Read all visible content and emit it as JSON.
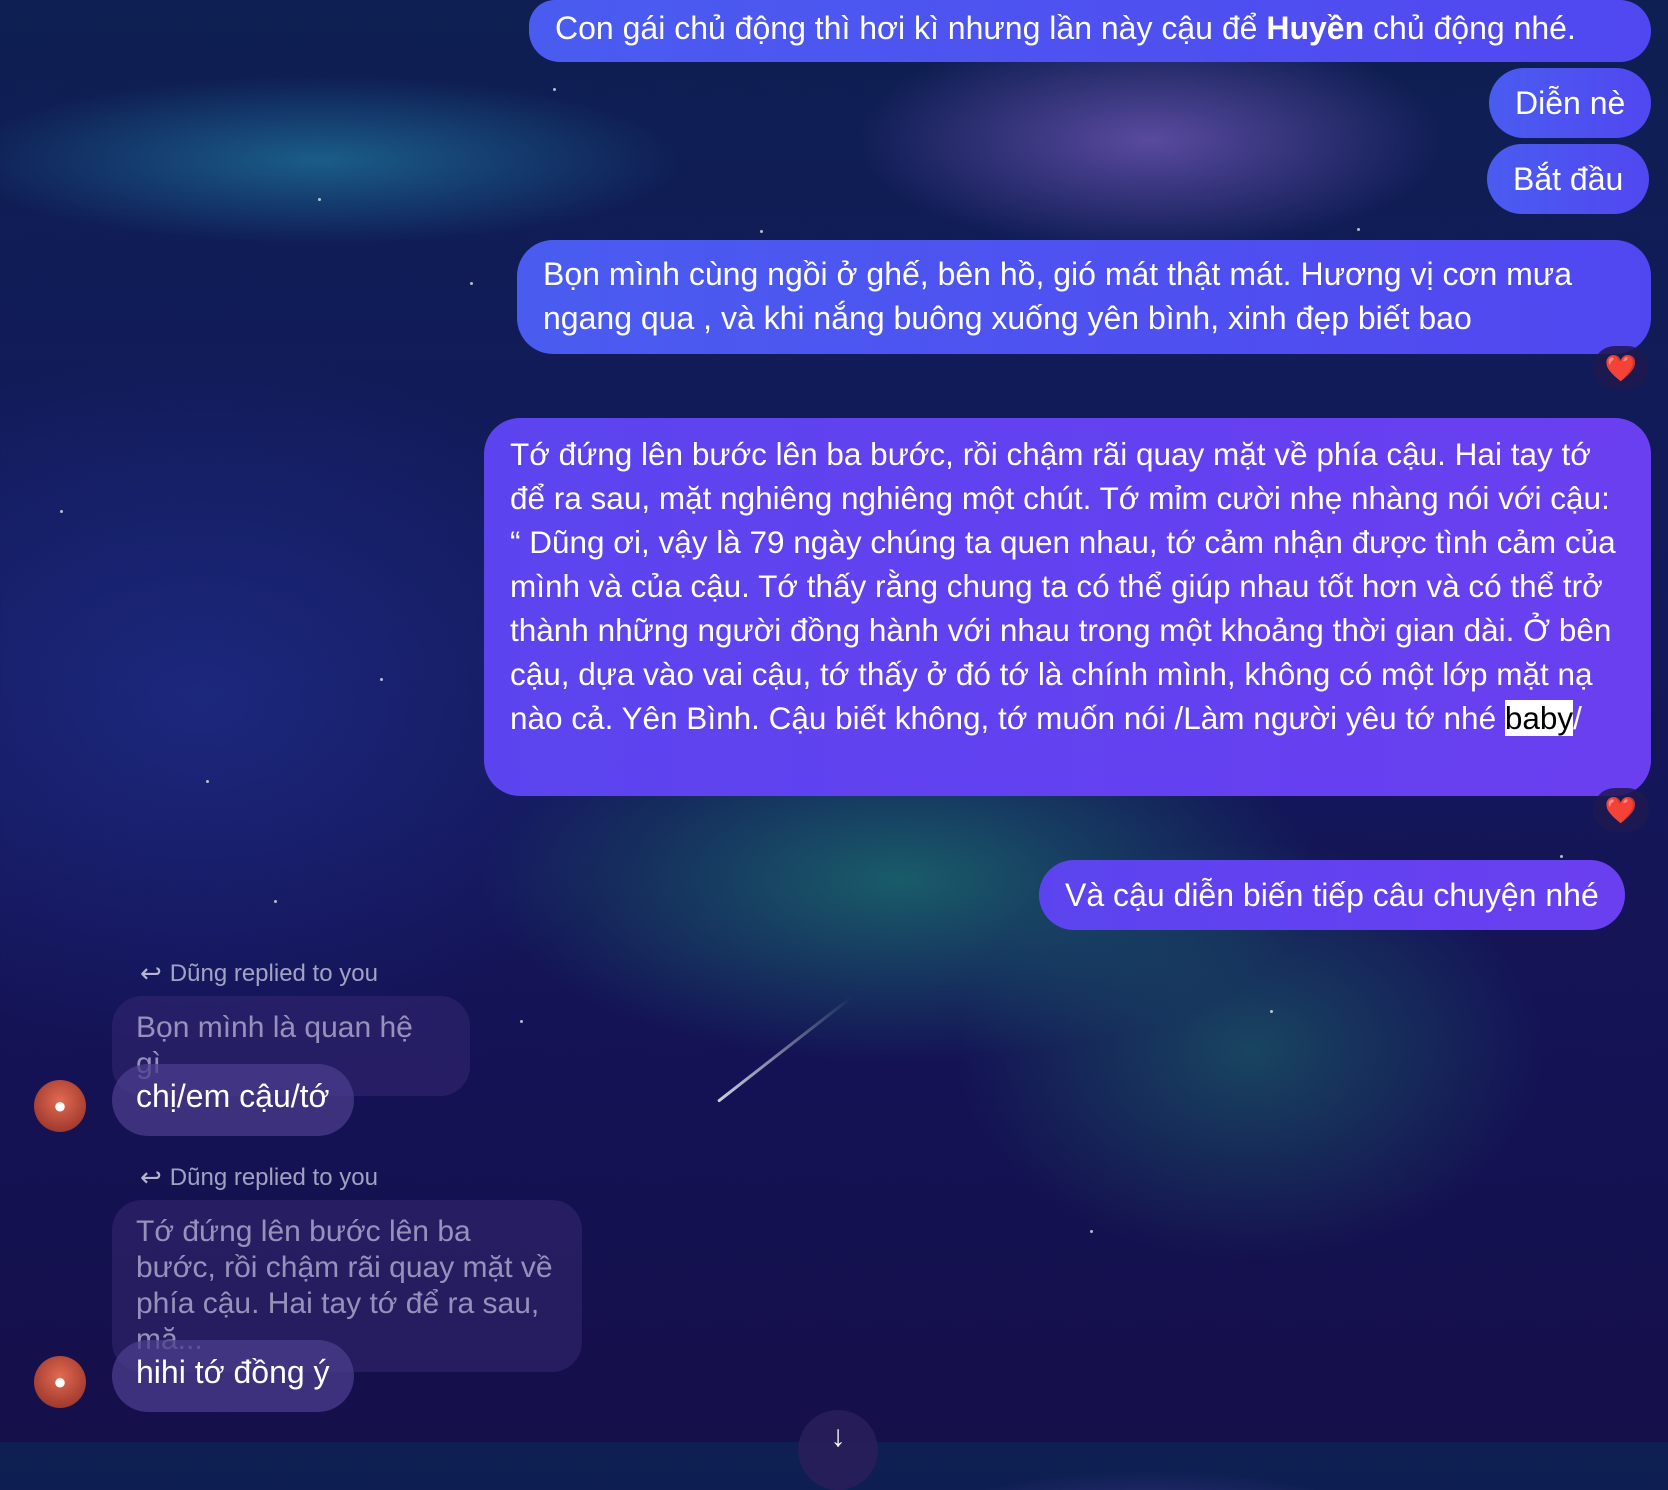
{
  "messages_out": [
    {
      "id": "m1",
      "text_before": "Con gái chủ động thì hơi kì nhưng lần này cậu để ",
      "bold": "Huyền",
      "text_after": " chủ động nhé."
    },
    {
      "id": "m2",
      "text": "Diễn nè"
    },
    {
      "id": "m3",
      "text": "Bắt đầu"
    },
    {
      "id": "m4",
      "text": "Bọn mình cùng ngồi ở ghế, bên hồ, gió mát thật mát. Hương vị cơn mưa ngang qua , và khi nắng buông xuống yên bình, xinh đẹp biết bao",
      "reaction": "❤️"
    },
    {
      "id": "m5",
      "text_main": "Tớ đứng lên bước lên ba bước, rồi chậm rãi quay mặt về phía cậu. Hai tay tớ để ra sau, mặt nghiêng nghiêng một chút. Tớ mỉm cười nhẹ nhàng nói với cậu: “ Dũng ơi, vậy là 79 ngày chúng ta quen nhau, tớ cảm nhận được tình cảm của mình và của cậu. Tớ thấy rằng chung ta có thể giúp nhau tốt hơn và có thể trở thành những người đồng hành với nhau trong một khoảng thời gian dài. Ở bên cậu, dựa vào vai cậu, tớ thấy ở đó tớ là chính mình, không có một lớp mặt nạ nào cả. Yên Bình. Cậu biết không, tớ muốn nói /Làm người yêu tớ nhé ",
      "text_highlight": "baby",
      "text_end": "/",
      "reaction": "❤️"
    },
    {
      "id": "m6",
      "text": "Và cậu diễn biến tiếp câu chuyện nhé"
    }
  ],
  "replies": [
    {
      "label": "Dũng replied to you",
      "quoted": "Bọn mình là quan hệ gì",
      "message": "chị/em cậu/tớ"
    },
    {
      "label": "Dũng replied to you",
      "quoted": "Tớ đứng lên bước lên ba bước, rồi chậm rãi quay mặt về phía cậu. Hai tay tớ để ra sau, mă...",
      "message": "hihi tớ đồng ý"
    }
  ],
  "icons": {
    "reply": "reply-arrow-icon",
    "avatar": "contact-avatar",
    "scroll": "scroll-down-button"
  },
  "colors": {
    "outgoing_bubble": "#4a5cf0",
    "outgoing_bubble_purple": "#6a3ff0",
    "reaction_heart": "#ff3040"
  }
}
